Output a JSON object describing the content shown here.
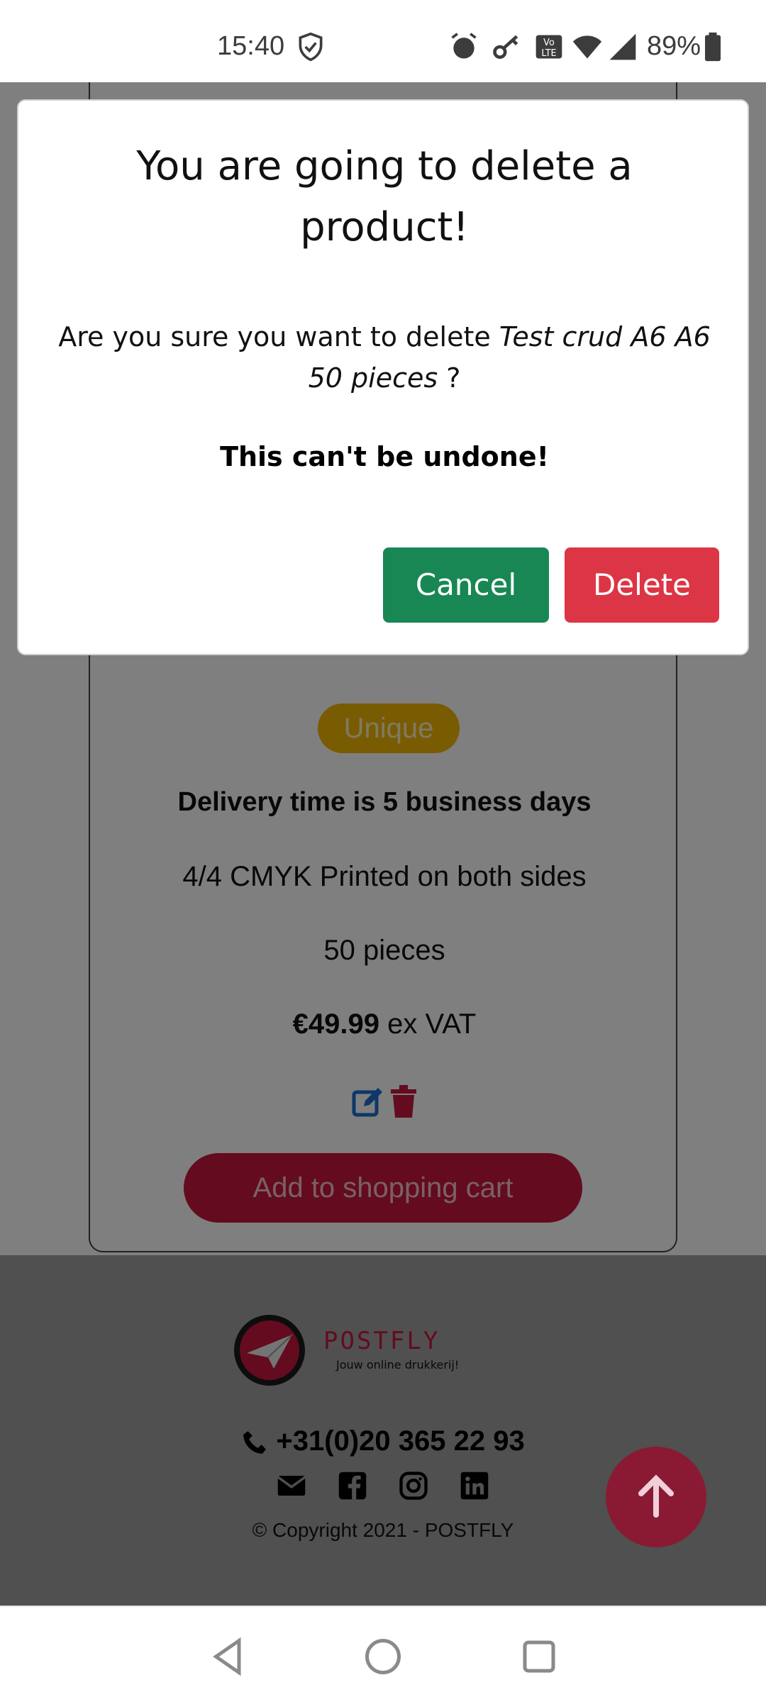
{
  "status_bar": {
    "time": "15:40",
    "battery": "89%",
    "icons": [
      "shield-check-icon",
      "alarm-icon",
      "key-icon",
      "volte-icon",
      "wifi-icon",
      "signal-icon",
      "battery-icon"
    ]
  },
  "product_card": {
    "title": "Test crud A6 A6",
    "badge": "Unique",
    "delivery": "Delivery time is 5 business days",
    "print": "4/4 CMYK Printed on both sides",
    "pieces": "50 pieces",
    "price": "€49.99",
    "price_suffix": "ex VAT",
    "cart_button": "Add to shopping cart"
  },
  "footer": {
    "logo_name": "POSTFLY",
    "logo_tagline": "Jouw online drukkerij!",
    "phone": "+31(0)20 365 22 93",
    "copyright": "© Copyright 2021 - POSTFLY",
    "social": [
      "mail-icon",
      "facebook-icon",
      "instagram-icon",
      "linkedin-icon"
    ]
  },
  "modal": {
    "title": "You are going to delete a product!",
    "body_prefix": "Are you sure you want to delete ",
    "product_name": "Test crud A6 A6 50 pieces",
    "body_suffix": " ?",
    "warning": "This can't be undone!",
    "cancel_label": "Cancel",
    "delete_label": "Delete"
  },
  "colors": {
    "cancel": "#198754",
    "delete": "#dc3545",
    "brand": "#c8173f",
    "badge": "#f2b705"
  }
}
